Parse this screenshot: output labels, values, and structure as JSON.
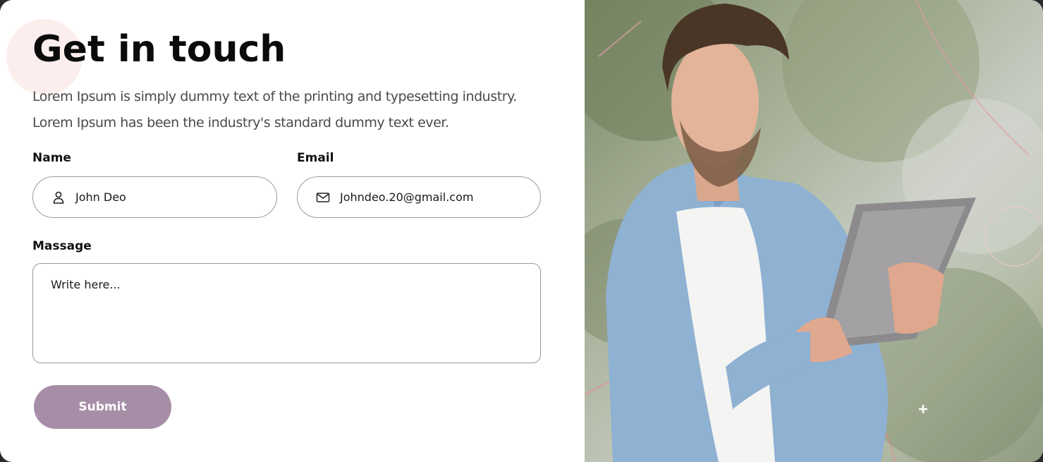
{
  "contact": {
    "title": "Get in touch",
    "description_line1": "Lorem Ipsum is simply dummy text of the printing and typesetting industry.",
    "description_line2": "Lorem Ipsum has been the industry's standard dummy text ever.",
    "name_label": "Name",
    "name_value": "John Deo",
    "email_label": "Email",
    "email_value": "Johndeo.20@gmail.com",
    "message_label": "Massage",
    "message_placeholder": "Write here...",
    "submit_label": "Submit"
  },
  "icons": {
    "name_field": "user-icon",
    "email_field": "mail-icon"
  },
  "colors": {
    "submit_bg": "#a78ea7",
    "accent_circle": "#fdeeee"
  },
  "photo": {
    "subject": "man-using-tablet"
  }
}
